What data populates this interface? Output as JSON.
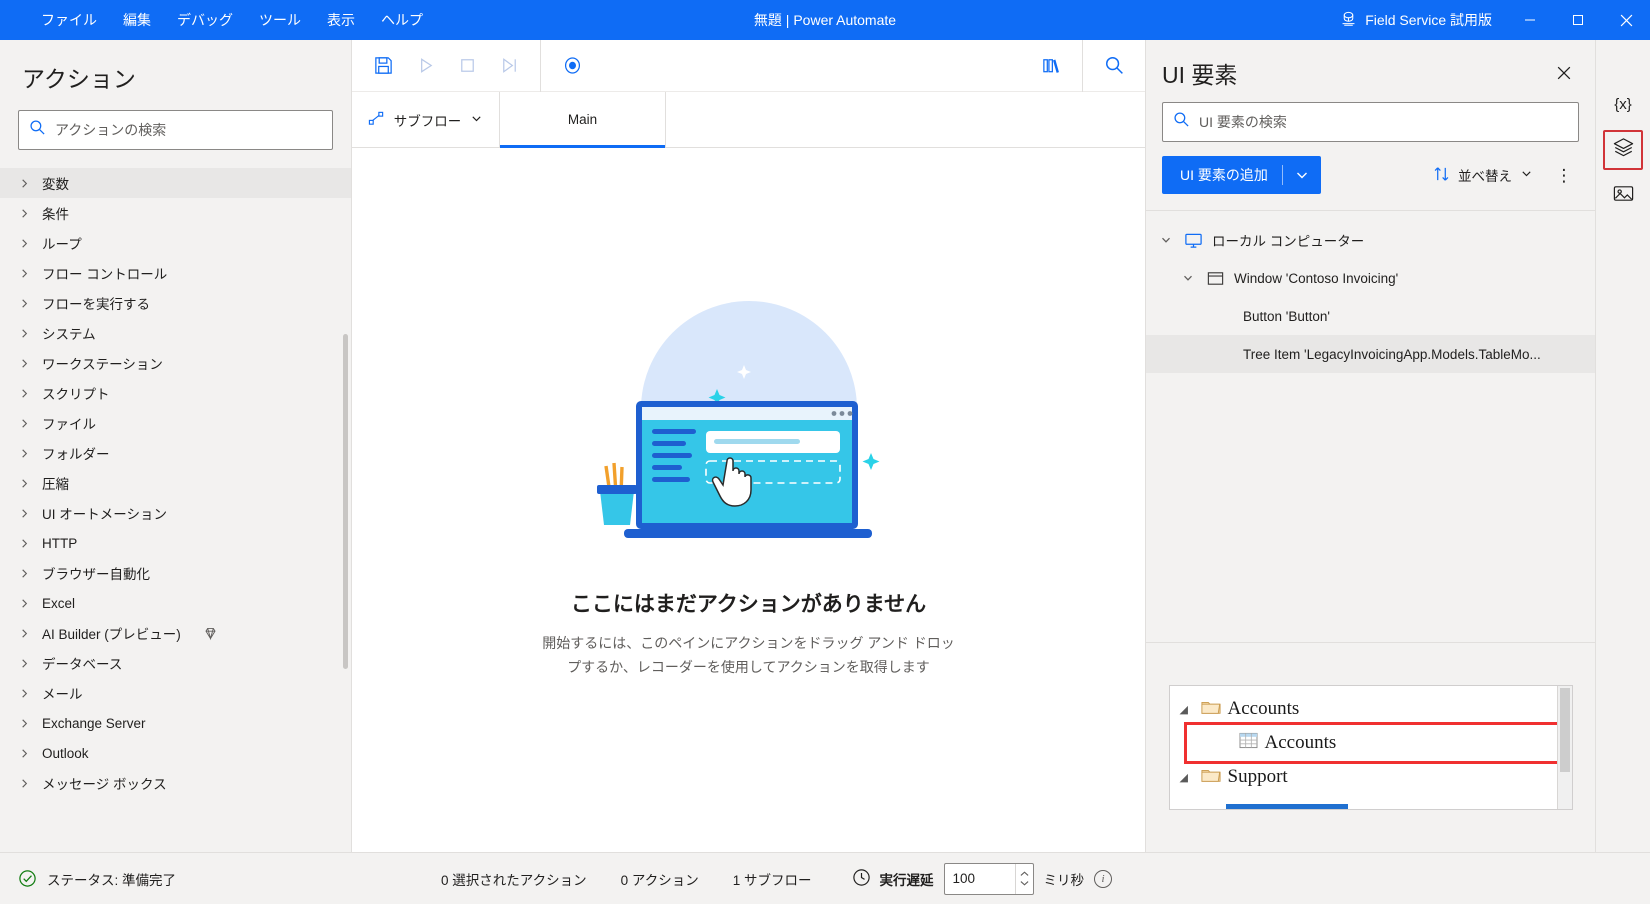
{
  "titlebar": {
    "menus": [
      "ファイル",
      "編集",
      "デバッグ",
      "ツール",
      "表示",
      "ヘルプ"
    ],
    "title": "無題 | Power Automate",
    "trial_label": "Field Service 試用版",
    "accent_color": "#0f6cf5",
    "minimize": "—",
    "maximize": "□",
    "close": "✕"
  },
  "actions_panel": {
    "title": "アクション",
    "search_placeholder": "アクションの検索",
    "search_value": "",
    "items": [
      {
        "label": "変数",
        "selected": true,
        "gem": false
      },
      {
        "label": "条件",
        "selected": false,
        "gem": false
      },
      {
        "label": "ループ",
        "selected": false,
        "gem": false
      },
      {
        "label": "フロー コントロール",
        "selected": false,
        "gem": false
      },
      {
        "label": "フローを実行する",
        "selected": false,
        "gem": false
      },
      {
        "label": "システム",
        "selected": false,
        "gem": false
      },
      {
        "label": "ワークステーション",
        "selected": false,
        "gem": false
      },
      {
        "label": "スクリプト",
        "selected": false,
        "gem": false
      },
      {
        "label": "ファイル",
        "selected": false,
        "gem": false
      },
      {
        "label": "フォルダー",
        "selected": false,
        "gem": false
      },
      {
        "label": "圧縮",
        "selected": false,
        "gem": false
      },
      {
        "label": "UI オートメーション",
        "selected": false,
        "gem": false
      },
      {
        "label": "HTTP",
        "selected": false,
        "gem": false
      },
      {
        "label": "ブラウザー自動化",
        "selected": false,
        "gem": false
      },
      {
        "label": "Excel",
        "selected": false,
        "gem": false
      },
      {
        "label": "AI Builder (プレビュー)",
        "selected": false,
        "gem": true
      },
      {
        "label": "データベース",
        "selected": false,
        "gem": false
      },
      {
        "label": "メール",
        "selected": false,
        "gem": false
      },
      {
        "label": "Exchange Server",
        "selected": false,
        "gem": false
      },
      {
        "label": "Outlook",
        "selected": false,
        "gem": false
      },
      {
        "label": "メッセージ ボックス",
        "selected": false,
        "gem": false
      }
    ]
  },
  "toolbar": {
    "save_icon": "save-icon",
    "run_icon": "play-icon",
    "stop_icon": "stop-icon",
    "step_icon": "run-next-action-icon",
    "record_icon": "recorder-icon",
    "library_icon": "ui-elements-library-icon",
    "search_icon": "search-icon"
  },
  "tabs": {
    "subflow_label": "サブフロー",
    "main_label": "Main"
  },
  "canvas": {
    "empty_title": "ここにはまだアクションがありません",
    "empty_sub_line1": "開始するには、このペインにアクションをドラッグ アンド ドロッ",
    "empty_sub_line2": "プするか、レコーダーを使用してアクションを取得します"
  },
  "ui_panel": {
    "title": "UI 要素",
    "close_label": "✕",
    "search_placeholder": "UI 要素の検索",
    "search_value": "",
    "add_button_label": "UI 要素の追加",
    "add_button_caret": "⌄",
    "sort_label": "並べ替え",
    "sort_caret": "⌄",
    "more_label": "⋮",
    "tree": [
      {
        "level": 0,
        "label": "ローカル コンピューター",
        "icon": "monitor-icon",
        "expanded": true,
        "selected": false
      },
      {
        "level": 1,
        "label": "Window 'Contoso Invoicing'",
        "icon": "window-icon",
        "expanded": true,
        "selected": false
      },
      {
        "level": 2,
        "label": "Button 'Button'",
        "icon": "none",
        "expanded": null,
        "selected": false
      },
      {
        "level": 2,
        "label": "Tree Item 'LegacyInvoicingApp.Models.TableMo...",
        "icon": "none",
        "expanded": null,
        "selected": true
      }
    ],
    "preview": {
      "rows": [
        {
          "label": "Accounts",
          "icon": "folder-icon",
          "indent": false,
          "caret": "◢"
        },
        {
          "label": "Accounts",
          "icon": "table-icon",
          "indent": true,
          "caret": ""
        },
        {
          "label": "Support",
          "icon": "folder-icon",
          "indent": false,
          "caret": "◢"
        }
      ],
      "highlight_color": "#f03030"
    }
  },
  "rail": {
    "items": [
      {
        "name": "variables-icon",
        "label": "{x}",
        "active": false
      },
      {
        "name": "ui-elements-icon",
        "label": "",
        "active": true
      },
      {
        "name": "images-icon",
        "label": "",
        "active": false
      }
    ]
  },
  "statusbar": {
    "status_label": "ステータス: 準備完了",
    "selected_actions": "0 選択されたアクション",
    "actions_count": "0 アクション",
    "subflows_count": "1 サブフロー",
    "delay_label": "実行遅延",
    "delay_value": "100",
    "delay_unit": "ミリ秒"
  }
}
